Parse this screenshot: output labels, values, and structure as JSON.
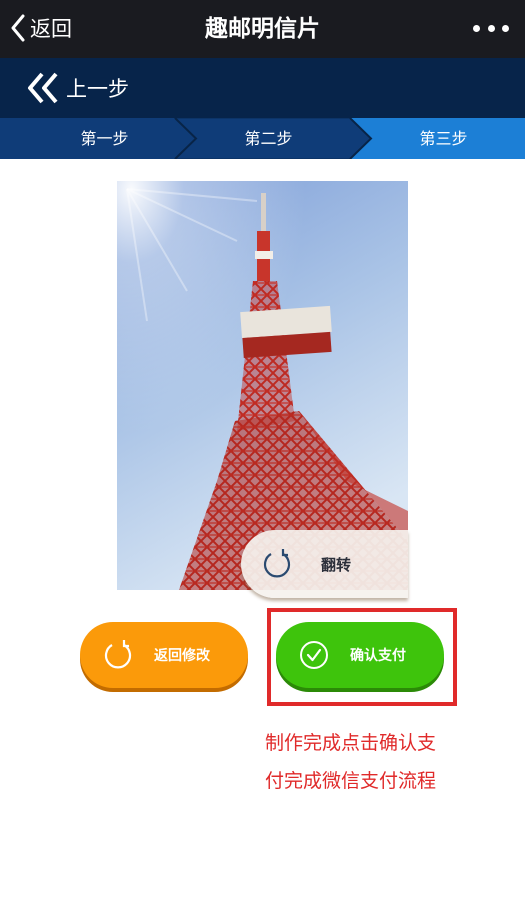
{
  "header": {
    "back_label": "返回",
    "title": "趣邮明信片",
    "more_icon": "more-dots-icon"
  },
  "prev_step": {
    "label": "上一步",
    "icon": "double-chevron-left-icon"
  },
  "steps": {
    "items": [
      {
        "label": "第一步",
        "active": false
      },
      {
        "label": "第二步",
        "active": false
      },
      {
        "label": "第三步",
        "active": true
      }
    ]
  },
  "photo": {
    "flip_label": "翻转",
    "flip_icon": "rotate-icon"
  },
  "actions": {
    "edit_label": "返回修改",
    "edit_icon": "rotate-icon",
    "confirm_label": "确认支付",
    "confirm_icon": "check-circle-icon"
  },
  "annotation": {
    "line1": "制作完成点击确认支",
    "line2": "付完成微信支付流程"
  },
  "colors": {
    "title_bar": "#1a1b20",
    "prev_bar": "#07244a",
    "steps_bg": "#0f3c78",
    "step_active": "#1c7fd6",
    "edit_button": "#fb9a0a",
    "confirm_button": "#3ec40c",
    "annotation_red": "#e02a2a"
  }
}
